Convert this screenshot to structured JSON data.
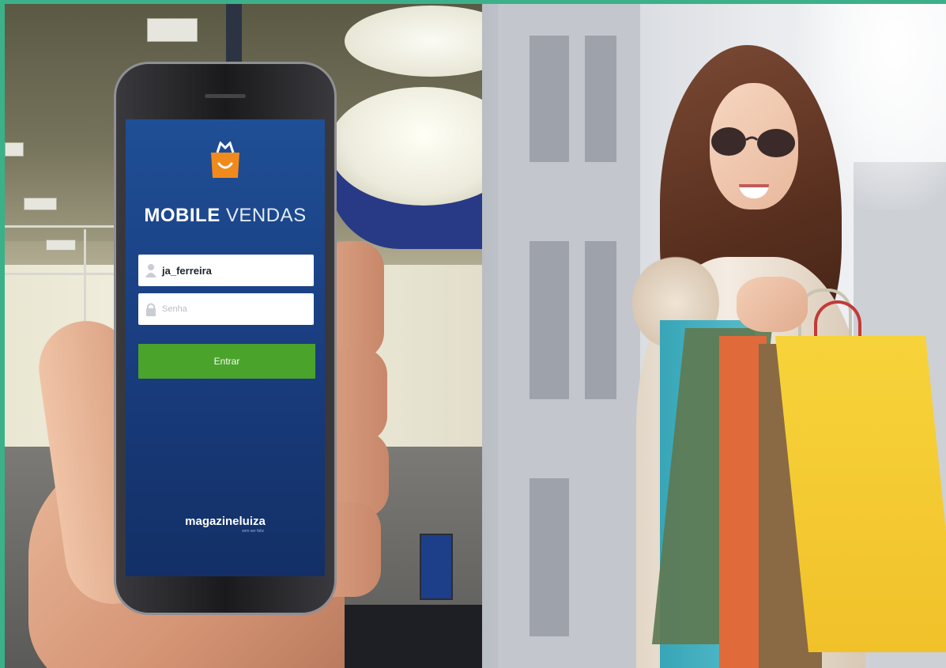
{
  "app": {
    "title_bold": "MOBILE",
    "title_light": "VENDAS",
    "username_value": "ja_ferreira",
    "password_placeholder": "Senha",
    "login_button": "Entrar",
    "footer_brand": "magazineluiza",
    "footer_tagline": "vem ser feliz"
  },
  "icons": {
    "app_logo": "shopping-bag-icon",
    "user_field": "user-icon",
    "password_field": "lock-icon"
  },
  "colors": {
    "border": "#3cb089",
    "app_background": "#1f4f96",
    "login_button": "#4aa32b",
    "logo_bag": "#f08a1c"
  }
}
